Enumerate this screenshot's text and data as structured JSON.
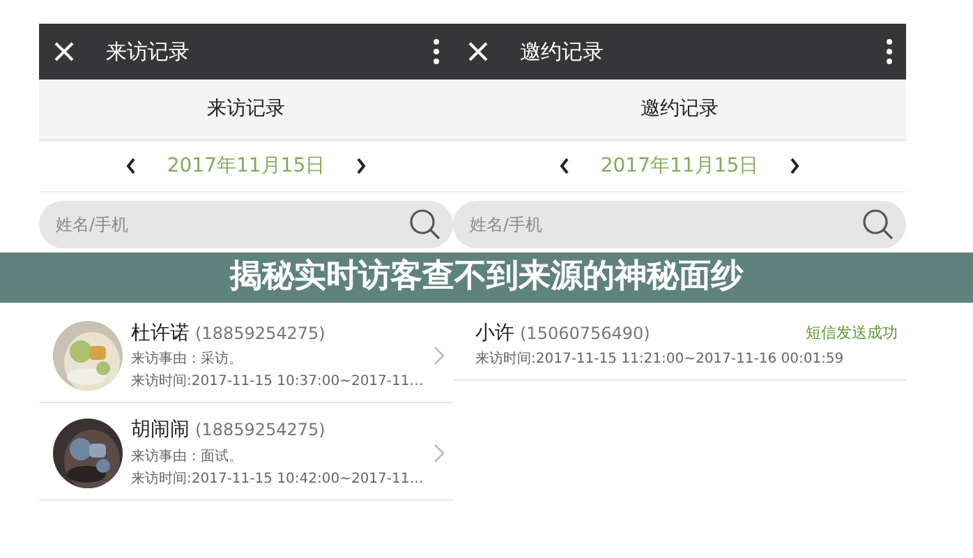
{
  "banner": {
    "title": "揭秘实时访客查不到来源的神秘面纱"
  },
  "panels": [
    {
      "title": "来访记录",
      "header": "来访记录",
      "date": "2017年11月15日",
      "search": {
        "placeholder": "姓名/手机"
      },
      "records": [
        {
          "kind": "visit",
          "name": "杜许诺",
          "phone": "(18859254275)",
          "reason": "来访事由：采访。",
          "time": "来访时间:2017-11-15 10:37:00~2017-11…"
        },
        {
          "kind": "visit",
          "name": "胡闹闹",
          "phone": "(18859254275)",
          "reason": "来访事由：面试。",
          "time": "来访时间:2017-11-15 10:42:00~2017-11…"
        }
      ]
    },
    {
      "title": "邀约记录",
      "header": "邀约记录",
      "date": "2017年11月15日",
      "search": {
        "placeholder": "姓名/手机"
      },
      "records": [
        {
          "kind": "invite",
          "name": "小许",
          "phone": "(15060756490)",
          "status": "短信发送成功",
          "time": "来访时间:2017-11-15 11:21:00~2017-11-16 00:01:59"
        }
      ]
    }
  ]
}
